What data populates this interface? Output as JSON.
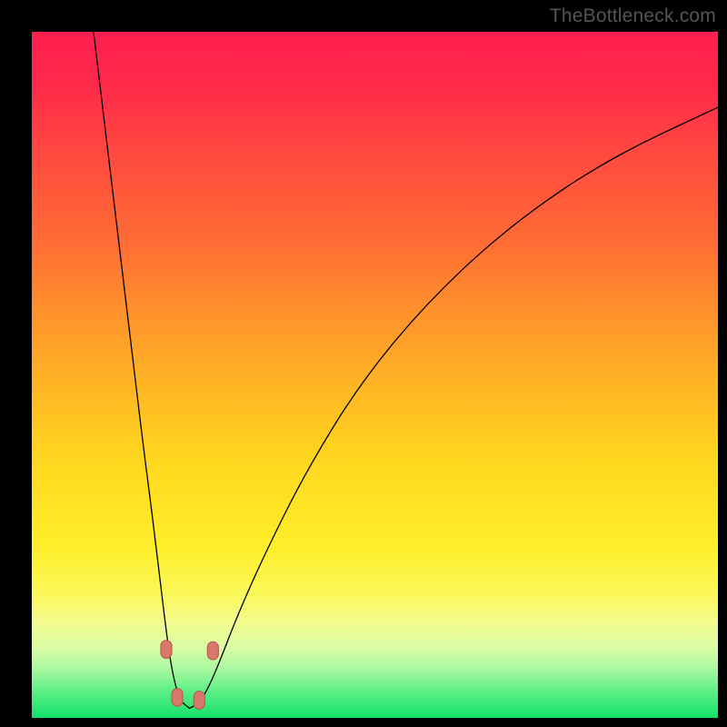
{
  "watermark": "TheBottleneck.com",
  "colors": {
    "black": "#000000",
    "curve": "#000000",
    "marker_fill": "#d9776b",
    "marker_stroke": "#b85a4f",
    "green_base": "#13e06a"
  },
  "chart_data": {
    "type": "line",
    "title": "",
    "xlabel": "",
    "ylabel": "",
    "xlim": [
      0,
      100
    ],
    "ylim": [
      0,
      100
    ],
    "notch_x": 23,
    "gradient_stops": [
      {
        "offset": 0.0,
        "color": "#ff1f4f"
      },
      {
        "offset": 0.08,
        "color": "#ff2a4a"
      },
      {
        "offset": 0.18,
        "color": "#ff4a3f"
      },
      {
        "offset": 0.3,
        "color": "#ff6a35"
      },
      {
        "offset": 0.45,
        "color": "#ffa028"
      },
      {
        "offset": 0.62,
        "color": "#ffd61f"
      },
      {
        "offset": 0.75,
        "color": "#ffee2a"
      },
      {
        "offset": 0.82,
        "color": "#fbf85a"
      },
      {
        "offset": 0.86,
        "color": "#f4fb8d"
      },
      {
        "offset": 0.9,
        "color": "#d8fca6"
      },
      {
        "offset": 0.93,
        "color": "#a6f8a0"
      },
      {
        "offset": 0.96,
        "color": "#5fef86"
      },
      {
        "offset": 1.0,
        "color": "#13e06a"
      }
    ],
    "left_branch": [
      {
        "x": 9.0,
        "y": 100.0
      },
      {
        "x": 10.2,
        "y": 90.0
      },
      {
        "x": 11.4,
        "y": 80.0
      },
      {
        "x": 12.6,
        "y": 70.0
      },
      {
        "x": 13.8,
        "y": 60.0
      },
      {
        "x": 15.0,
        "y": 50.0
      },
      {
        "x": 16.2,
        "y": 40.0
      },
      {
        "x": 17.5,
        "y": 30.0
      },
      {
        "x": 18.7,
        "y": 20.0
      },
      {
        "x": 19.8,
        "y": 11.0
      },
      {
        "x": 20.6,
        "y": 6.0
      },
      {
        "x": 21.6,
        "y": 2.5
      },
      {
        "x": 23.0,
        "y": 1.4
      }
    ],
    "right_branch": [
      {
        "x": 23.0,
        "y": 1.4
      },
      {
        "x": 24.4,
        "y": 2.2
      },
      {
        "x": 25.8,
        "y": 4.5
      },
      {
        "x": 27.5,
        "y": 8.5
      },
      {
        "x": 30.0,
        "y": 15.0
      },
      {
        "x": 34.0,
        "y": 24.0
      },
      {
        "x": 40.0,
        "y": 36.0
      },
      {
        "x": 48.0,
        "y": 49.0
      },
      {
        "x": 58.0,
        "y": 61.0
      },
      {
        "x": 70.0,
        "y": 72.0
      },
      {
        "x": 84.0,
        "y": 81.5
      },
      {
        "x": 100.0,
        "y": 89.0
      }
    ],
    "markers": [
      {
        "x": 19.6,
        "y": 10.0
      },
      {
        "x": 21.2,
        "y": 3.0
      },
      {
        "x": 24.4,
        "y": 2.6
      },
      {
        "x": 26.4,
        "y": 9.8
      }
    ]
  }
}
